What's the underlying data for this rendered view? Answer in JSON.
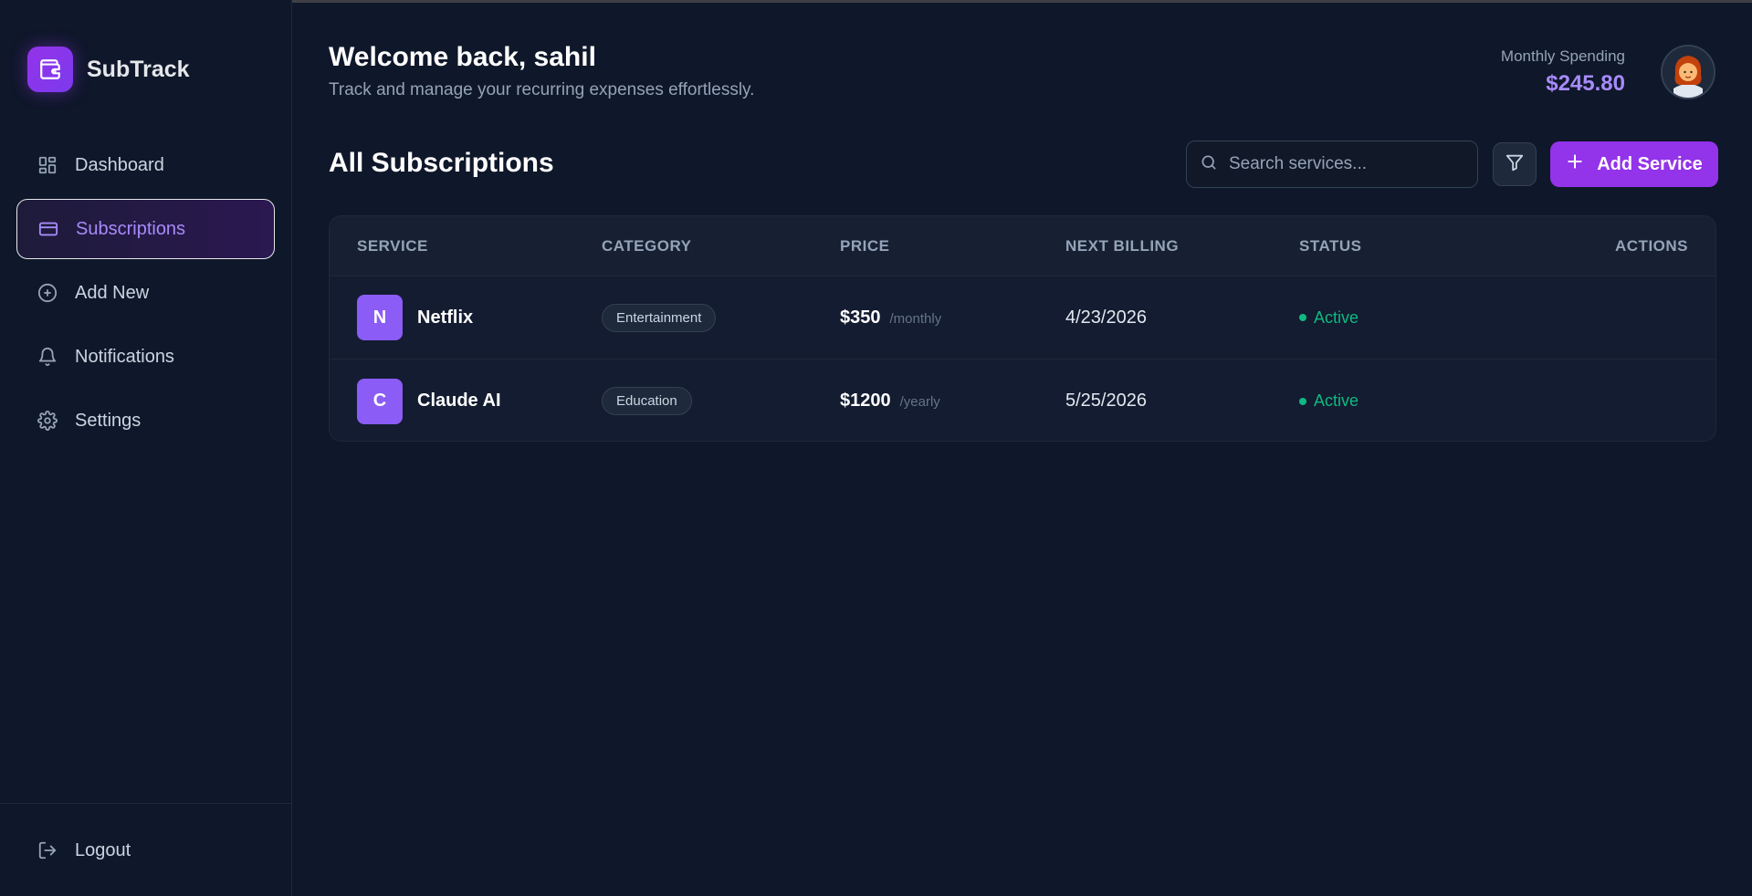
{
  "brand": {
    "name": "SubTrack"
  },
  "sidebar": {
    "items": [
      {
        "label": "Dashboard",
        "icon": "dashboard-icon",
        "active": false
      },
      {
        "label": "Subscriptions",
        "icon": "credit-card-icon",
        "active": true
      },
      {
        "label": "Add New",
        "icon": "plus-circle-icon",
        "active": false
      },
      {
        "label": "Notifications",
        "icon": "bell-icon",
        "active": false
      },
      {
        "label": "Settings",
        "icon": "gear-icon",
        "active": false
      }
    ],
    "logout_label": "Logout"
  },
  "header": {
    "welcome": "Welcome back, sahil",
    "tagline": "Track and manage your recurring expenses effortlessly.",
    "spending_label": "Monthly Spending",
    "spending_value": "$245.80"
  },
  "subscriptions": {
    "title": "All Subscriptions",
    "search_placeholder": "Search services...",
    "add_button_label": "Add Service",
    "columns": {
      "service": "SERVICE",
      "category": "CATEGORY",
      "price": "PRICE",
      "next_billing": "NEXT BILLING",
      "status": "STATUS",
      "actions": "ACTIONS"
    },
    "rows": [
      {
        "initial": "N",
        "name": "Netflix",
        "category": "Entertainment",
        "price": "$350",
        "period": "/monthly",
        "next_billing": "4/23/2026",
        "status": "Active"
      },
      {
        "initial": "C",
        "name": "Claude AI",
        "category": "Education",
        "price": "$1200",
        "period": "/yearly",
        "next_billing": "5/25/2026",
        "status": "Active"
      }
    ]
  },
  "colors": {
    "background": "#0f172a",
    "accent": "#9333ea",
    "accent_text": "#a78bfa",
    "status_active": "#10b981"
  }
}
